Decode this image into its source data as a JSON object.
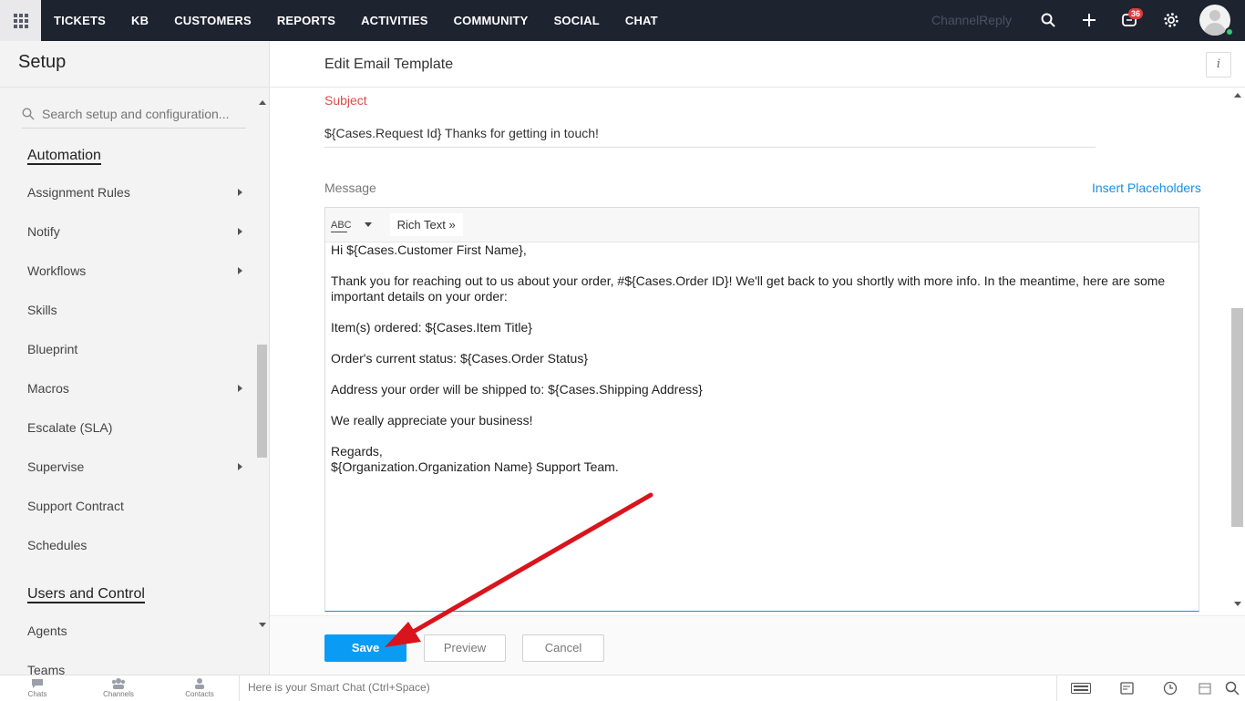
{
  "topnav": {
    "items": [
      "TICKETS",
      "KB",
      "CUSTOMERS",
      "REPORTS",
      "ACTIVITIES",
      "COMMUNITY",
      "SOCIAL",
      "CHAT"
    ],
    "brand": "ChannelReply",
    "notification_count": "36"
  },
  "sidebar": {
    "title": "Setup",
    "search_placeholder": "Search setup and configuration...",
    "sections": [
      {
        "heading": "Automation",
        "items": [
          {
            "label": "Assignment Rules",
            "has_submenu": true
          },
          {
            "label": "Notify",
            "has_submenu": true
          },
          {
            "label": "Workflows",
            "has_submenu": true
          },
          {
            "label": "Skills",
            "has_submenu": false
          },
          {
            "label": "Blueprint",
            "has_submenu": false
          },
          {
            "label": "Macros",
            "has_submenu": true
          },
          {
            "label": "Escalate (SLA)",
            "has_submenu": false
          },
          {
            "label": "Supervise",
            "has_submenu": true
          },
          {
            "label": "Support Contract",
            "has_submenu": false
          },
          {
            "label": "Schedules",
            "has_submenu": false
          }
        ]
      },
      {
        "heading": "Users and Control",
        "items": [
          {
            "label": "Agents",
            "has_submenu": false
          },
          {
            "label": "Teams",
            "has_submenu": false
          }
        ]
      }
    ]
  },
  "main": {
    "title": "Edit Email Template",
    "subject_label": "Subject",
    "subject_value": "${Cases.Request Id} Thanks for getting in touch!",
    "message_label": "Message",
    "insert_placeholders": "Insert Placeholders",
    "toolbar": {
      "spellcheck": "ABC",
      "rich_text": "Rich Text »"
    },
    "message_lines": [
      "Hi ${Cases.Customer First Name},",
      "Thank you for reaching out to us about your order, #${Cases.Order ID}! We'll get back to you shortly with more info. In the meantime, here are some important details on your order:",
      "Item(s) ordered: ${Cases.Item Title}",
      "Order's current status: ${Cases.Order Status}",
      "Address your order will be shipped to: ${Cases.Shipping Address}",
      "We really appreciate your business!",
      "Regards,",
      "${Organization.Organization Name} Support Team."
    ],
    "buttons": {
      "save": "Save",
      "preview": "Preview",
      "cancel": "Cancel"
    }
  },
  "bottombar": {
    "items": [
      "Chats",
      "Channels",
      "Contacts"
    ],
    "smart_chat_placeholder": "Here is your Smart Chat (Ctrl+Space)"
  },
  "colors": {
    "accent": "#0a9cf5",
    "topbar": "#1e2330",
    "subject_label": "#e04b4b",
    "annotation_arrow": "#d9141c"
  }
}
